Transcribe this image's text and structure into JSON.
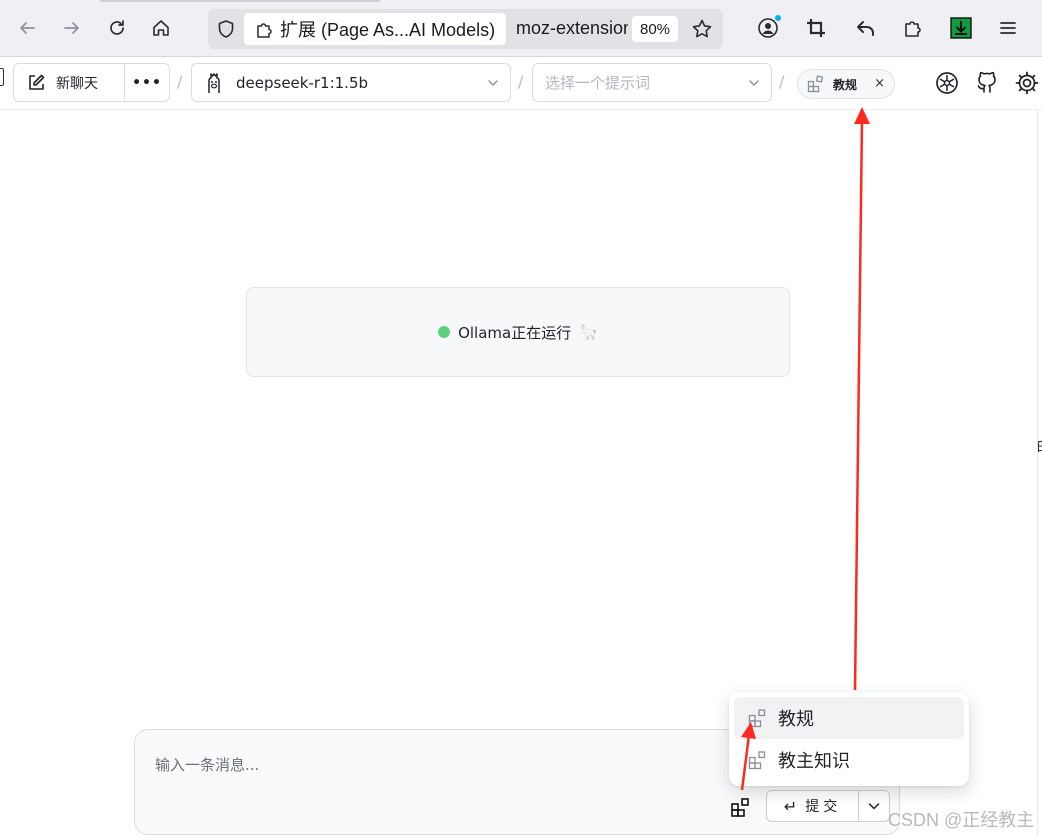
{
  "browser": {
    "tab_title": "扩展 (Page As...AI Models)",
    "url_text": "moz-extension",
    "zoom": "80%"
  },
  "app": {
    "new_chat_label": "新聊天",
    "more_label": "•••",
    "separator": "/",
    "model_select": {
      "value": "deepseek-r1:1.5b"
    },
    "prompt_select": {
      "placeholder": "选择一个提示词"
    },
    "knowledge_chip": {
      "label": "教规",
      "close": "×"
    }
  },
  "status": {
    "text": "Ollama正在运行",
    "emoji": "🦙",
    "dot_color": "#5fcf80"
  },
  "composer": {
    "placeholder": "输入一条消息...",
    "submit_label": "提交",
    "submit_icon": "↵"
  },
  "knowledge_menu": {
    "items": [
      {
        "label": "教规",
        "active": true
      },
      {
        "label": "教主知识",
        "active": false
      }
    ]
  },
  "annotation": {
    "arrow_color": "#ff2a1f"
  },
  "watermark": "CSDN @正经教主",
  "edge_glyph": "白"
}
